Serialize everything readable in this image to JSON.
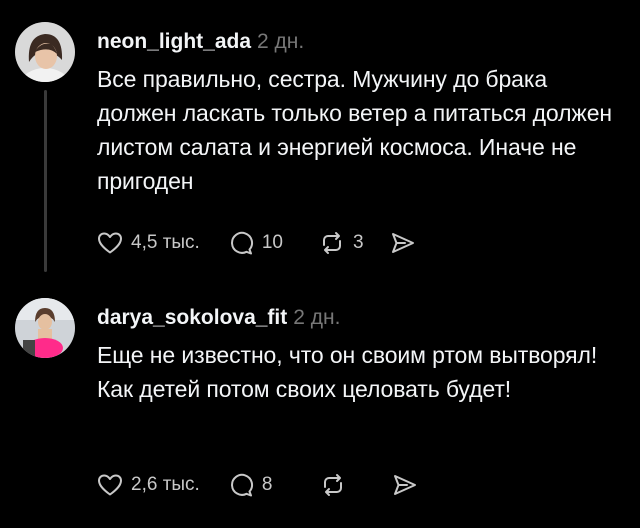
{
  "comments": [
    {
      "username": "neon_light_ada",
      "time": "2 дн.",
      "text": "Все правильно, сестра. Мужчину до брака должен ласкать только ветер а питаться должен листом салата и энергией космоса. Иначе не пригоден",
      "likes": "4,5 тыс.",
      "replies": "10",
      "reposts": "3",
      "icons": [
        "heart-icon",
        "comment-icon",
        "repost-icon",
        "share-icon"
      ]
    },
    {
      "username": "darya_sokolova_fit",
      "time": "2 дн.",
      "text": "Еще не известно, что он своим ртом вытворял! Как детей потом своих целовать будет!",
      "likes": "2,6 тыс.",
      "replies": "8",
      "reposts": "",
      "icons": [
        "heart-icon",
        "comment-icon",
        "repost-icon",
        "share-icon"
      ]
    }
  ],
  "colors": {
    "background": "#000000",
    "text": "#f3f5f7",
    "muted": "#777777",
    "icon": "#c8c8c8"
  }
}
